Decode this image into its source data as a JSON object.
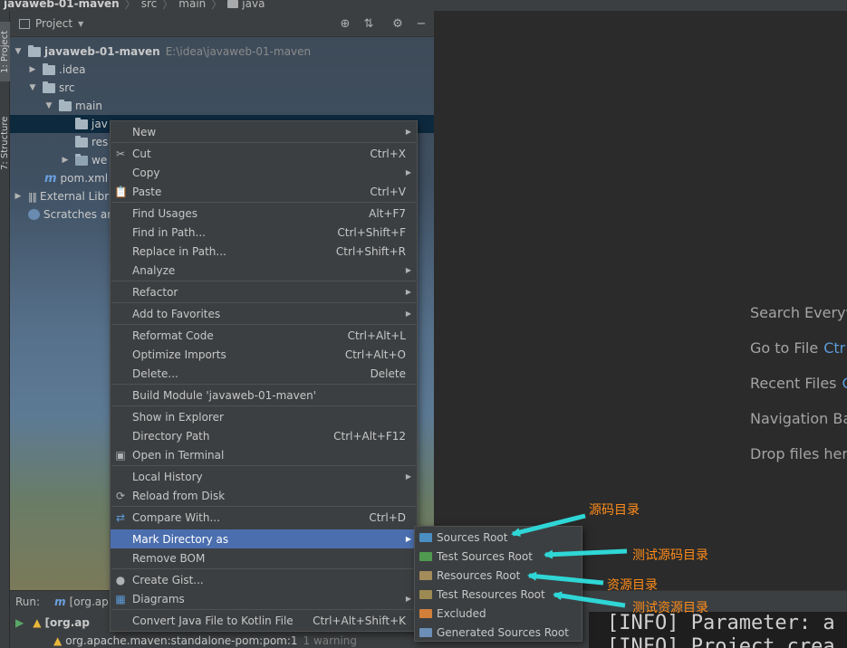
{
  "breadcrumb": [
    "javaweb-01-maven",
    "src",
    "main",
    "java"
  ],
  "tool_strip": {
    "project_tab": "1: Project",
    "structure_tab": "7: Structure"
  },
  "project_panel": {
    "title": "Project",
    "tree": [
      {
        "label": "javaweb-01-maven",
        "path": "E:\\idea\\javaweb-01-maven"
      },
      {
        "label": ".idea"
      },
      {
        "label": "src"
      },
      {
        "label": "main"
      },
      {
        "label": "jav"
      },
      {
        "label": "res"
      },
      {
        "label": "we"
      },
      {
        "label": "pom.xml"
      },
      {
        "label": "External Libr"
      },
      {
        "label": "Scratches ar"
      }
    ]
  },
  "editor_hints": [
    {
      "label": "Search Everyw",
      "key": ""
    },
    {
      "label": "Go to File",
      "key": "Ctr"
    },
    {
      "label": "Recent Files",
      "key": "C"
    },
    {
      "label": "Navigation Ba",
      "key": ""
    },
    {
      "label": "Drop files here",
      "key": ""
    }
  ],
  "context_menu": {
    "items": [
      {
        "label": "New",
        "shortcut": "",
        "submenu": true
      },
      {
        "label": "Cut",
        "shortcut": "Ctrl+X",
        "submenu": false,
        "icon": "cut-icon"
      },
      {
        "label": "Copy",
        "shortcut": "",
        "submenu": true
      },
      {
        "label": "Paste",
        "shortcut": "Ctrl+V",
        "submenu": false,
        "icon": "paste-icon"
      },
      {
        "label": "Find Usages",
        "shortcut": "Alt+F7",
        "submenu": false
      },
      {
        "label": "Find in Path...",
        "shortcut": "Ctrl+Shift+F",
        "submenu": false
      },
      {
        "label": "Replace in Path...",
        "shortcut": "Ctrl+Shift+R",
        "submenu": false
      },
      {
        "label": "Analyze",
        "shortcut": "",
        "submenu": true
      },
      {
        "label": "Refactor",
        "shortcut": "",
        "submenu": true
      },
      {
        "label": "Add to Favorites",
        "shortcut": "",
        "submenu": true
      },
      {
        "label": "Reformat Code",
        "shortcut": "Ctrl+Alt+L",
        "submenu": false
      },
      {
        "label": "Optimize Imports",
        "shortcut": "Ctrl+Alt+O",
        "submenu": false
      },
      {
        "label": "Delete...",
        "shortcut": "Delete",
        "submenu": false
      },
      {
        "label": "Build Module 'javaweb-01-maven'",
        "shortcut": "",
        "submenu": false
      },
      {
        "label": "Show in Explorer",
        "shortcut": "",
        "submenu": false
      },
      {
        "label": "Directory Path",
        "shortcut": "Ctrl+Alt+F12",
        "submenu": false
      },
      {
        "label": "Open in Terminal",
        "shortcut": "",
        "submenu": false,
        "icon": "terminal-icon"
      },
      {
        "label": "Local History",
        "shortcut": "",
        "submenu": true
      },
      {
        "label": "Reload from Disk",
        "shortcut": "",
        "submenu": false,
        "icon": "reload-icon"
      },
      {
        "label": "Compare With...",
        "shortcut": "Ctrl+D",
        "submenu": false,
        "icon": "compare-icon"
      },
      {
        "label": "Mark Directory as",
        "shortcut": "",
        "submenu": true
      },
      {
        "label": "Remove BOM",
        "shortcut": "",
        "submenu": false
      },
      {
        "label": "Create Gist...",
        "shortcut": "",
        "submenu": false,
        "icon": "github-icon"
      },
      {
        "label": "Diagrams",
        "shortcut": "",
        "submenu": true,
        "icon": "diagram-icon"
      },
      {
        "label": "Convert Java File to Kotlin File",
        "shortcut": "Ctrl+Alt+Shift+K",
        "submenu": false
      }
    ]
  },
  "mark_submenu": {
    "items": [
      {
        "label": "Sources Root",
        "color": "#4a8ec2"
      },
      {
        "label": "Test Sources Root",
        "color": "#4f9a4f"
      },
      {
        "label": "Resources Root",
        "color": "#a38b5a"
      },
      {
        "label": "Test Resources Root",
        "color": "#9c8a52"
      },
      {
        "label": "Excluded",
        "color": "#d27f3a"
      },
      {
        "label": "Generated Sources Root",
        "color": "#6b8fb6"
      }
    ]
  },
  "annotations": [
    {
      "text": "源码目录"
    },
    {
      "text": "测试源码目录"
    },
    {
      "text": "资源目录"
    },
    {
      "text": "测试资源目录"
    }
  ],
  "run_panel": {
    "label": "Run:",
    "tab": "[org.ap",
    "row1": "[org.ap",
    "row2": "org.apache.maven:standalone-pom:pom:1",
    "row2_warn": "1 warning"
  },
  "console": [
    "[INFO] Parameter: a",
    "[INFO] Project crea"
  ],
  "colors": {
    "accent": "#4b6eaf",
    "annotation": "#ff8c1a",
    "arrow": "#2fd6d6"
  }
}
